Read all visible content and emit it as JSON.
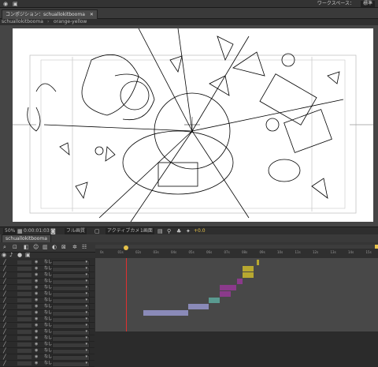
{
  "app": {
    "workspace_label": "ワークスペース：",
    "workspace_value": "標準"
  },
  "tabs": [
    {
      "label": "コンポジション：schuallokitbooma"
    },
    {
      "label": "schuallokitbooma"
    },
    {
      "label": "orange-yellow"
    }
  ],
  "viewer_controls": {
    "zoom": "50%",
    "timecode": "0:00:01:03",
    "resolution": "フル画質",
    "camera": "アクティブカメラ",
    "views": "1画面",
    "offset": "+0.0"
  },
  "timeline": {
    "tab_label": "schuallokitbooma",
    "ruler_ticks": [
      "0s",
      "01s",
      "02s",
      "03s",
      "04s",
      "05s",
      "06s",
      "07s",
      "08s",
      "09s",
      "10s",
      "11s",
      "12s",
      "13s",
      "14s",
      "15s"
    ],
    "layer_name": "なし",
    "layer_count": 17,
    "colors": {
      "yellow": "#b8a830",
      "purple": "#8b3a8b",
      "teal": "#5a9a90",
      "lavender": "#8a8ab8",
      "playhead": "#e03030"
    },
    "blocks": [
      {
        "color": "yellow",
        "row": 0,
        "start": 0.57,
        "end": 0.58
      },
      {
        "color": "yellow",
        "row": 1,
        "start": 0.52,
        "end": 0.56
      },
      {
        "color": "yellow",
        "row": 2,
        "start": 0.52,
        "end": 0.56
      },
      {
        "color": "purple",
        "row": 3,
        "start": 0.5,
        "end": 0.52
      },
      {
        "color": "purple",
        "row": 4,
        "start": 0.44,
        "end": 0.5
      },
      {
        "color": "purple",
        "row": 5,
        "start": 0.44,
        "end": 0.48
      },
      {
        "color": "teal",
        "row": 6,
        "start": 0.4,
        "end": 0.44
      },
      {
        "color": "lavender",
        "row": 7,
        "start": 0.33,
        "end": 0.4
      },
      {
        "color": "lavender",
        "row": 8,
        "start": 0.17,
        "end": 0.33
      }
    ],
    "playhead_fraction": 0.11
  }
}
